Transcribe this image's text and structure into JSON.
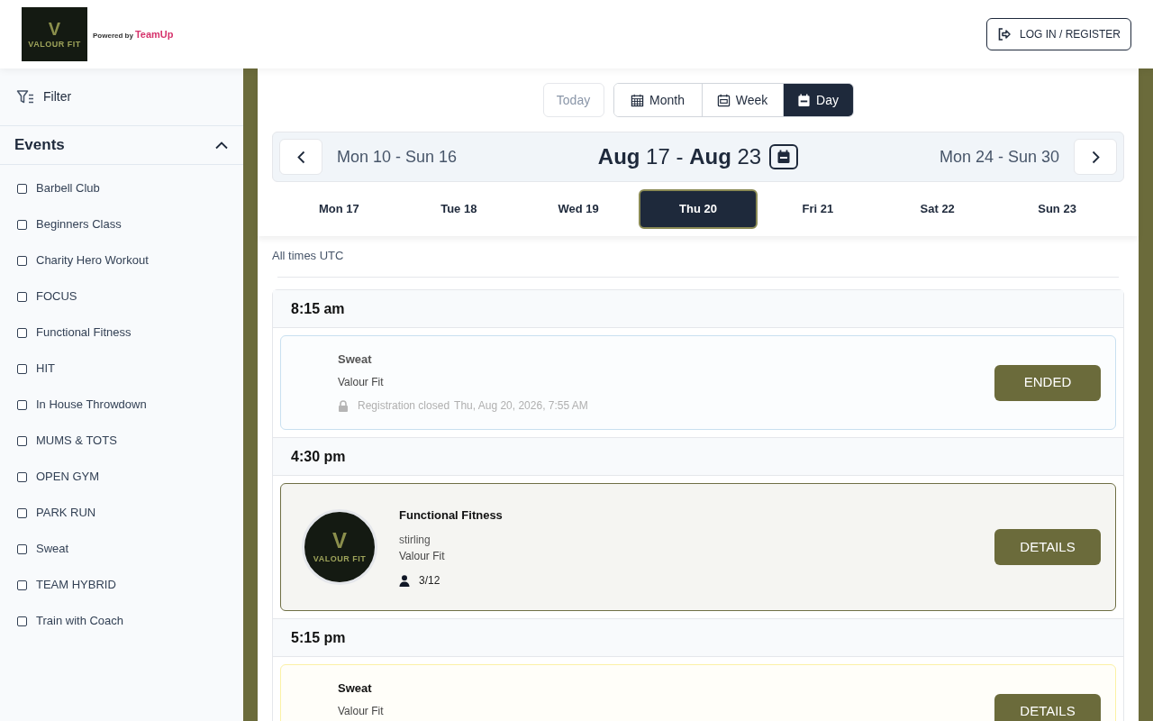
{
  "header": {
    "logo": {
      "monogram": "V",
      "name": "VALOUR FIT"
    },
    "powered_by": {
      "prefix": "Powered by",
      "brand": "TeamUp"
    },
    "login_button": "LOG IN / REGISTER"
  },
  "sidebar": {
    "filter": "Filter",
    "events": {
      "title": "Events",
      "expanded": true,
      "items": [
        {
          "label": "Barbell Club",
          "checked": false
        },
        {
          "label": "Beginners Class",
          "checked": false
        },
        {
          "label": "Charity Hero Workout",
          "checked": false
        },
        {
          "label": "FOCUS",
          "checked": false
        },
        {
          "label": "Functional Fitness",
          "checked": false
        },
        {
          "label": "HIT",
          "checked": false
        },
        {
          "label": "In House Throwdown",
          "checked": false
        },
        {
          "label": "MUMS & TOTS",
          "checked": false
        },
        {
          "label": "OPEN GYM",
          "checked": false
        },
        {
          "label": "PARK RUN",
          "checked": false
        },
        {
          "label": "Sweat",
          "checked": false
        },
        {
          "label": "TEAM HYBRID",
          "checked": false
        },
        {
          "label": "Train with Coach",
          "checked": false
        }
      ]
    }
  },
  "calendar": {
    "today_button": {
      "label": "Today",
      "disabled": true
    },
    "views": [
      {
        "kind": "month",
        "label": "Month",
        "selected": false
      },
      {
        "kind": "week",
        "label": "Week",
        "selected": false
      },
      {
        "kind": "day",
        "label": "Day",
        "selected": true
      }
    ],
    "range": {
      "previous": "Mon 10 - Sun 16",
      "current": "**Aug** 17 - **Aug** 23",
      "next": "Mon 24 - Sun 30"
    },
    "days": [
      {
        "label": "Mon 17",
        "selected": false
      },
      {
        "label": "Tue 18",
        "selected": false
      },
      {
        "label": "Wed 19",
        "selected": false
      },
      {
        "label": "Thu 20",
        "selected": true
      },
      {
        "label": "Fri 21",
        "selected": false
      },
      {
        "label": "Sat 22",
        "selected": false
      },
      {
        "label": "Sun 23",
        "selected": false
      }
    ],
    "timezone_note": "All times UTC",
    "slots": [
      {
        "time": "8:15 am",
        "events": [
          {
            "title": "Sweat",
            "ended": true,
            "color": "#c9e0f0",
            "venue": "Valour Fit",
            "registration": {
              "label": "Registration closed",
              "time": "Thu, Aug 20, 2026, 7:55 AM"
            },
            "button": "ENDED"
          }
        ]
      },
      {
        "time": "4:30 pm",
        "events": [
          {
            "title": "Functional Fitness",
            "ended": false,
            "color": "#6f6f45",
            "logo": {
              "monogram": "V",
              "name": "VALOUR FIT"
            },
            "location": "stirling",
            "venue": "Valour Fit",
            "attendance": "3/12",
            "button": "DETAILS"
          }
        ]
      },
      {
        "time": "5:15 pm",
        "events": [
          {
            "title": "Sweat",
            "ended": false,
            "color": "#fbf1a6",
            "venue": "Valour Fit",
            "button": "DETAILS"
          }
        ]
      }
    ]
  }
}
